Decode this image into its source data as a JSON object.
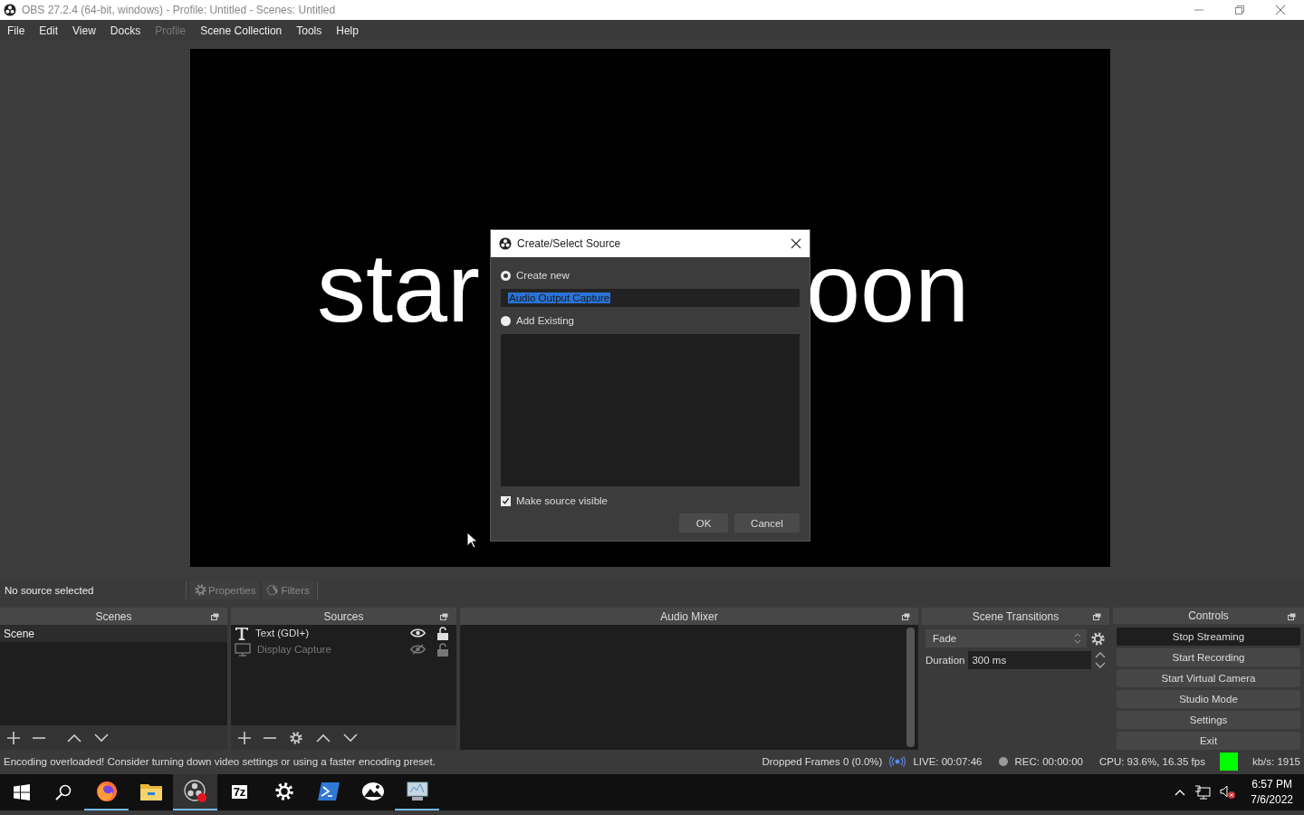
{
  "window": {
    "title": "OBS 27.2.4 (64-bit, windows) - Profile: Untitled - Scenes: Untitled"
  },
  "menu": [
    {
      "label": "File",
      "disabled": false
    },
    {
      "label": "Edit",
      "disabled": false
    },
    {
      "label": "View",
      "disabled": false
    },
    {
      "label": "Docks",
      "disabled": false
    },
    {
      "label": "Profile",
      "disabled": true
    },
    {
      "label": "Scene Collection",
      "disabled": false
    },
    {
      "label": "Tools",
      "disabled": false
    },
    {
      "label": "Help",
      "disabled": false
    }
  ],
  "preview": {
    "text_left": "star",
    "text_right": "oon"
  },
  "dialog": {
    "title": "Create/Select Source",
    "options": [
      {
        "kind": "create",
        "label": "Create new",
        "selected": true
      },
      {
        "kind": "existing",
        "label": "Add Existing",
        "selected": false
      }
    ],
    "name_value": "Audio Output Capture",
    "visible_label": "Make source visible",
    "visible_checked": true,
    "buttons": [
      "OK",
      "Cancel"
    ]
  },
  "source_toolbar": {
    "status": "No source selected",
    "buttons": [
      {
        "kind": "properties",
        "label": "Properties",
        "disabled": true
      },
      {
        "kind": "filters",
        "label": "Filters",
        "disabled": true
      }
    ]
  },
  "scenes": {
    "title": "Scenes",
    "items": [
      {
        "name": "Scene",
        "selected": true
      }
    ]
  },
  "sources": {
    "title": "Sources",
    "items": [
      {
        "kind": "text",
        "name": "Text (GDI+)",
        "visible": true
      },
      {
        "kind": "display",
        "name": "Display Capture",
        "visible": false
      }
    ]
  },
  "audio_mixer": {
    "title": "Audio Mixer"
  },
  "transitions": {
    "title": "Scene Transitions",
    "transition": "Fade",
    "duration_label": "Duration",
    "duration": "300 ms"
  },
  "controls": {
    "title": "Controls",
    "buttons": [
      {
        "label": "Stop Streaming",
        "active": true
      },
      {
        "label": "Start Recording",
        "active": false
      },
      {
        "label": "Start Virtual Camera",
        "active": false
      },
      {
        "label": "Studio Mode",
        "active": false
      },
      {
        "label": "Settings",
        "active": false
      },
      {
        "label": "Exit",
        "active": false
      }
    ]
  },
  "status_bar": {
    "message": "Encoding overloaded! Consider turning down video settings or using a faster encoding preset.",
    "dropped": "Dropped Frames 0 (0.0%)",
    "live": "LIVE: 00:07:46",
    "rec": "REC: 00:00:00",
    "cpu": "CPU: 93.6%, 16.35 fps",
    "kbps": "kb/s: 1915",
    "health_indicator": {
      "color": "#00ff00"
    }
  },
  "taskbar": {
    "apps": [
      {
        "kind": "firefox",
        "running": true,
        "active": false
      },
      {
        "kind": "explorer",
        "running": false,
        "active": false
      },
      {
        "kind": "obs",
        "running": true,
        "active": true
      },
      {
        "kind": "sevenzip",
        "label": "7z",
        "running": false,
        "active": false
      },
      {
        "kind": "settings",
        "running": false,
        "active": false
      },
      {
        "kind": "powershell",
        "running": false,
        "active": false
      },
      {
        "kind": "photo",
        "running": false,
        "active": false
      },
      {
        "kind": "monitor",
        "running": true,
        "active": false
      }
    ],
    "time": "6:57 PM",
    "date": "7/6/2022"
  }
}
